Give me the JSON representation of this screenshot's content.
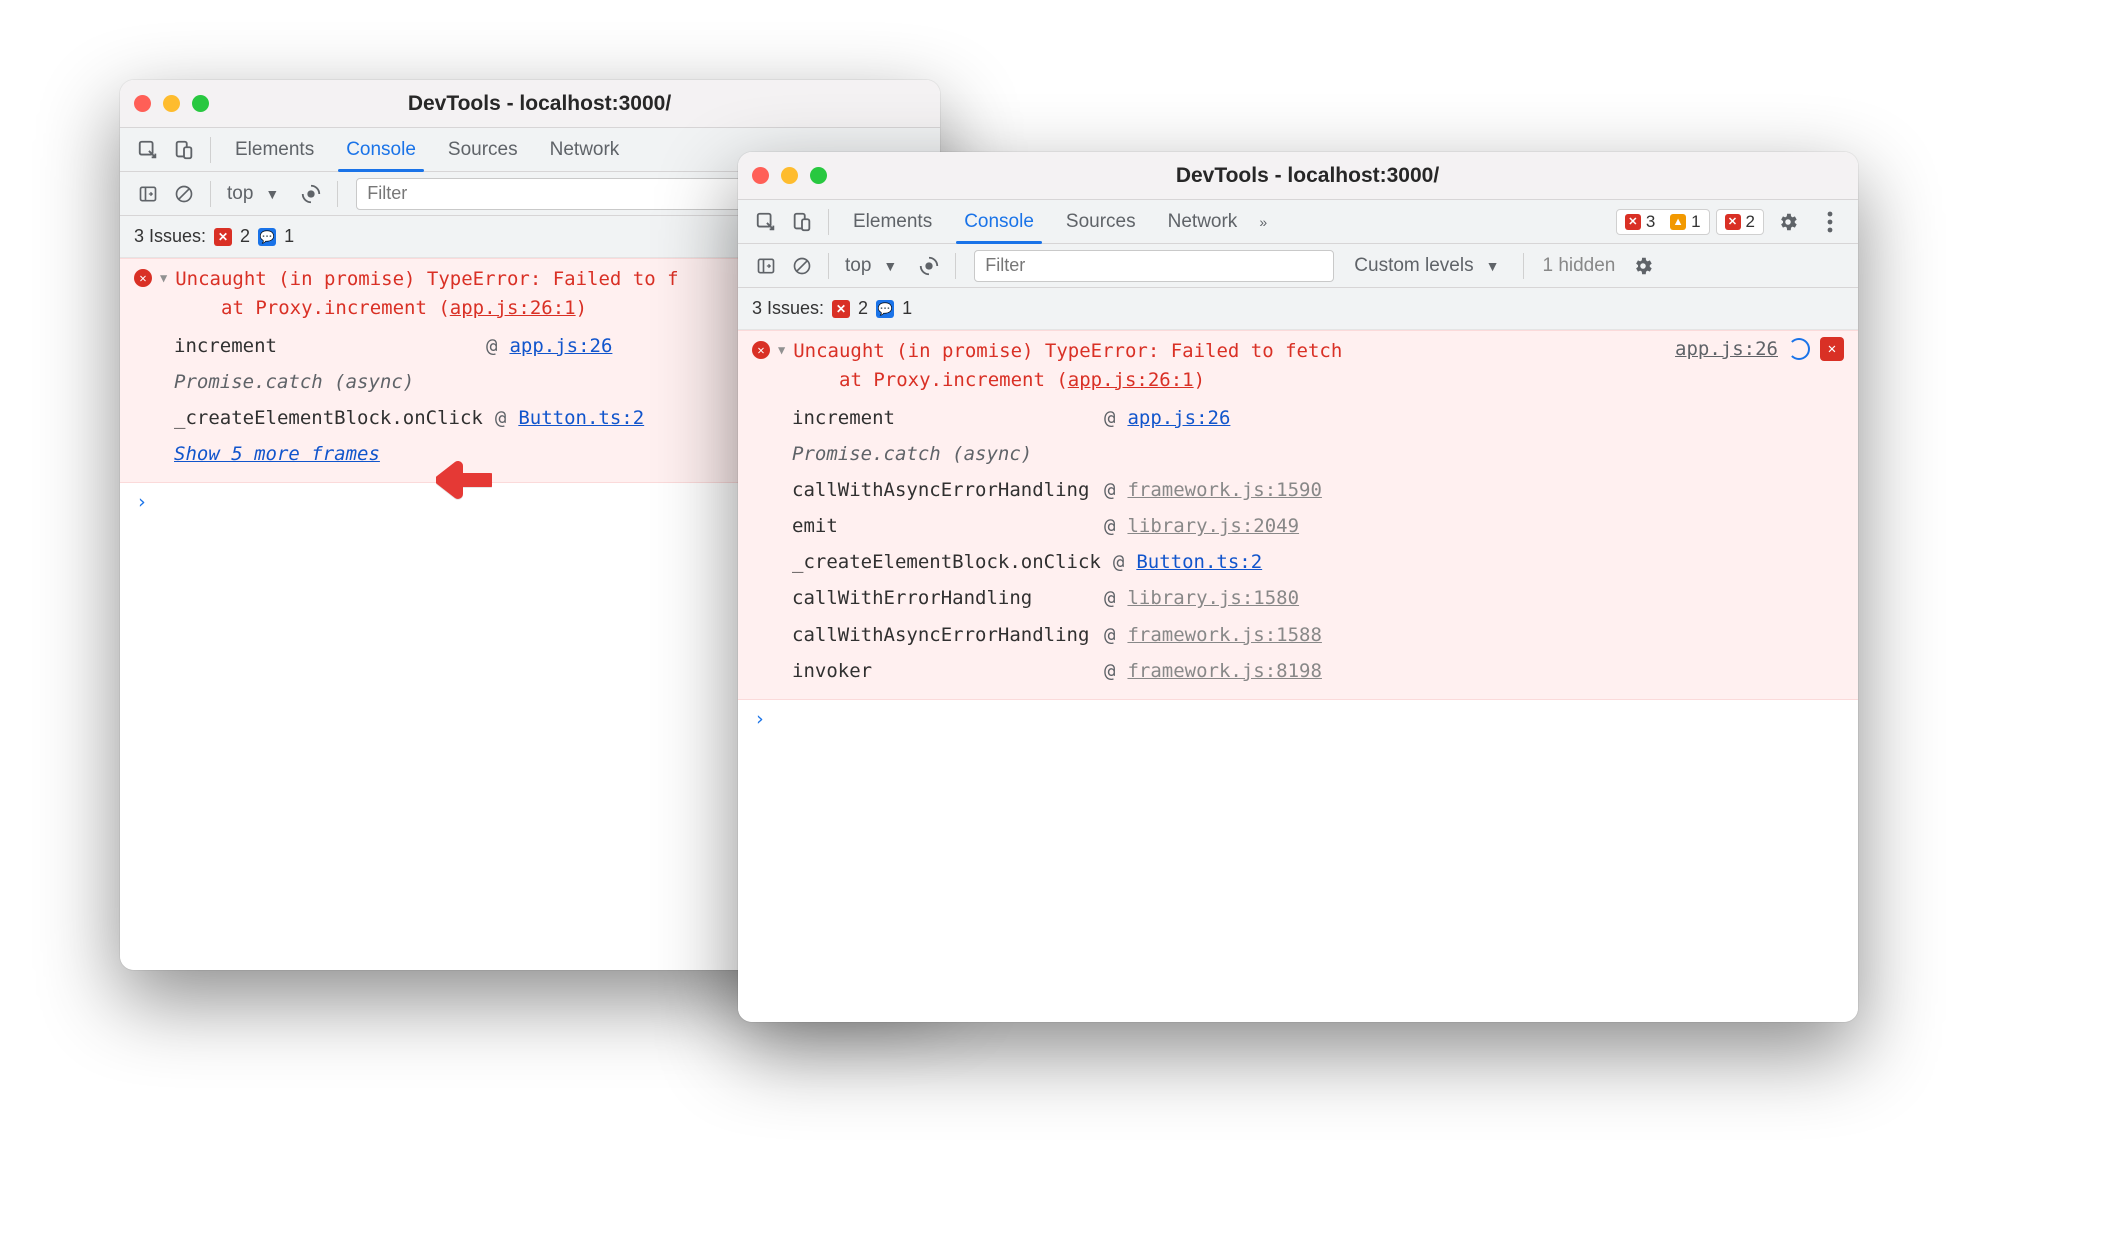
{
  "win1": {
    "title": "DevTools - localhost:3000/",
    "tabs": [
      "Elements",
      "Console",
      "Sources",
      "Network"
    ],
    "activeTab": "Console",
    "context": "top",
    "filterPlaceholder": "Filter",
    "issuesLabel": "3 Issues:",
    "issueErr": "2",
    "issueMsg": "1",
    "error": {
      "line1": "Uncaught (in promise) TypeError: Failed to f",
      "line2prefix": "at Proxy.increment (",
      "line2loc": "app.js:26:1",
      "line2suffix": ")"
    },
    "stack": [
      {
        "fn": "increment",
        "at": "@",
        "loc": "app.js:26",
        "cls": "link-blue"
      },
      {
        "fn": "Promise.catch (async)",
        "italic": true
      },
      {
        "fn": "_createElementBlock.onClick",
        "at": "@",
        "loc": "Button.ts:2",
        "cls": "link-blue"
      }
    ],
    "showMore": "Show 5 more frames",
    "prompt": "›"
  },
  "win2": {
    "title": "DevTools - localhost:3000/",
    "tabs": [
      "Elements",
      "Console",
      "Sources",
      "Network"
    ],
    "activeTab": "Console",
    "statusErr": "3",
    "statusWarn": "1",
    "statusMsg": "2",
    "context": "top",
    "filterPlaceholder": "Filter",
    "levels": "Custom levels",
    "hidden": "1 hidden",
    "issuesLabel": "3 Issues:",
    "issueErr": "2",
    "issueMsg": "1",
    "error": {
      "line1": "Uncaught (in promise) TypeError: Failed to fetch",
      "line2prefix": "at Proxy.increment (",
      "line2loc": "app.js:26:1",
      "line2suffix": ")",
      "rightLoc": "app.js:26"
    },
    "stack": [
      {
        "fn": "increment",
        "at": "@",
        "loc": "app.js:26",
        "cls": "link-blue"
      },
      {
        "fn": "Promise.catch (async)",
        "italic": true
      },
      {
        "fn": "callWithAsyncErrorHandling",
        "at": "@",
        "loc": "framework.js:1590",
        "cls": "link-gray"
      },
      {
        "fn": "emit",
        "at": "@",
        "loc": "library.js:2049",
        "cls": "link-gray"
      },
      {
        "fn": "_createElementBlock.onClick",
        "at": "@",
        "loc": "Button.ts:2",
        "cls": "link-blue"
      },
      {
        "fn": "callWithErrorHandling",
        "at": "@",
        "loc": "library.js:1580",
        "cls": "link-gray"
      },
      {
        "fn": "callWithAsyncErrorHandling",
        "at": "@",
        "loc": "framework.js:1588",
        "cls": "link-gray"
      },
      {
        "fn": "invoker",
        "at": "@",
        "loc": "framework.js:8198",
        "cls": "link-gray"
      }
    ],
    "prompt": "›"
  }
}
